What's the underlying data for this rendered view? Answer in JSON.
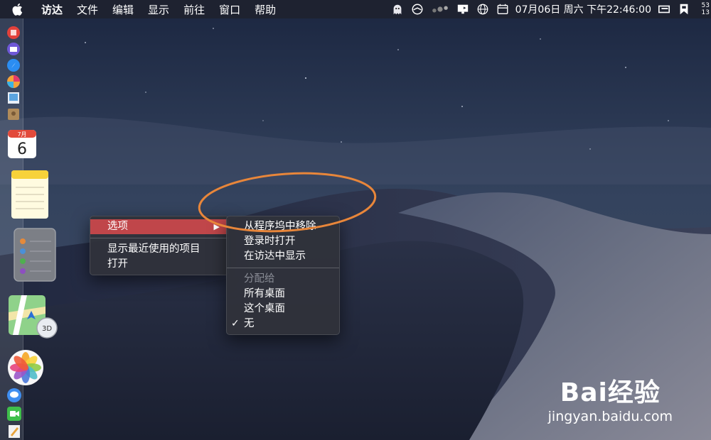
{
  "menubar": {
    "items": [
      "访达",
      "文件",
      "编辑",
      "显示",
      "前往",
      "窗口",
      "帮助"
    ],
    "status_icons": [
      "ghost-icon",
      "clock-sync-icon",
      "dots-icon",
      "display-icon",
      "globe-icon",
      "calendar-icon",
      "menu-extra-icon",
      "bookmark-icon"
    ],
    "datetime": "07月06日 周六 下午22:46:00",
    "corner_top": "53",
    "corner_bottom": "13"
  },
  "dock": {
    "calendar_month": "7月",
    "calendar_day": "6",
    "maps_badge": "3D"
  },
  "main_menu": {
    "items": [
      {
        "label": "选项",
        "highlighted": true,
        "submenu": true
      },
      {
        "label": "显示最近使用的项目"
      },
      {
        "label": "打开"
      }
    ],
    "arrow": "▶"
  },
  "sub_menu": {
    "items": [
      "从程序坞中移除",
      "登录时打开",
      "在访达中显示"
    ],
    "section_title": "分配给",
    "assign_items": [
      "所有桌面",
      "这个桌面",
      "无"
    ],
    "checked_item": "无",
    "check": "✓"
  },
  "annotation": {
    "color": "#e8863a"
  },
  "watermark": {
    "brand": "Bai经验",
    "url": "jingyan.baidu.com"
  },
  "colors": {
    "highlight": "#c0464a",
    "menubar": "#1e2230"
  }
}
